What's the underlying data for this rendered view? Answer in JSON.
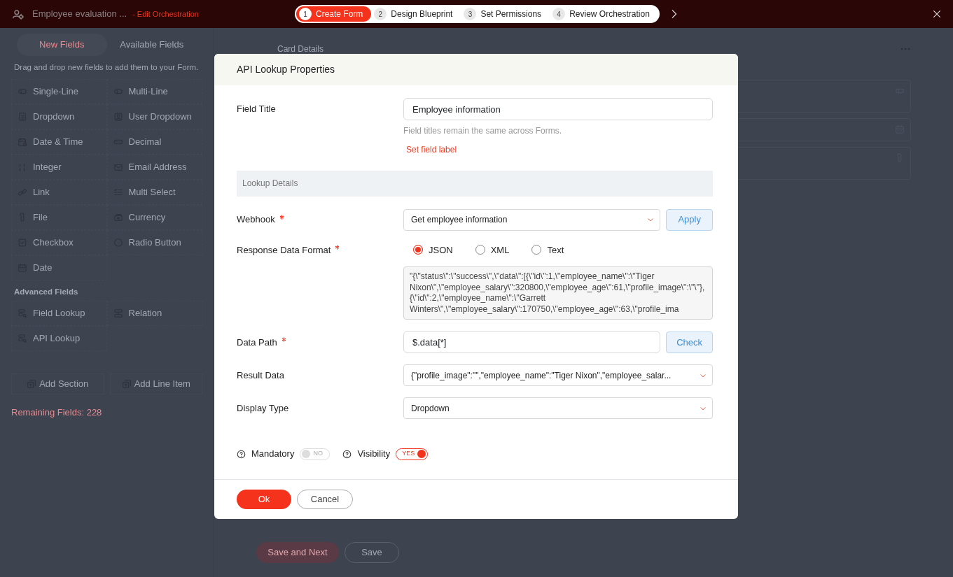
{
  "header": {
    "title": "Employee evaluation ...",
    "subtitle": "- Edit Orchestration",
    "steps": [
      {
        "number": "1",
        "label": "Create Form",
        "selected": true
      },
      {
        "number": "2",
        "label": "Design Blueprint",
        "selected": false
      },
      {
        "number": "3",
        "label": "Set Permissions",
        "selected": false
      },
      {
        "number": "4",
        "label": "Review Orchestration",
        "selected": false
      }
    ]
  },
  "sidebar": {
    "tabs": [
      {
        "label": "New Fields",
        "selected": true
      },
      {
        "label": "Available Fields",
        "selected": false
      }
    ],
    "hint": "Drag and drop new fields to add them to your Form.",
    "fields": [
      "Single-Line",
      "Multi-Line",
      "Dropdown",
      "User Dropdown",
      "Date & Time",
      "Decimal",
      "Integer",
      "Email Address",
      "Link",
      "Multi Select",
      "File",
      "Currency",
      "Checkbox",
      "Radio Button",
      "Date"
    ],
    "advanced_heading": "Advanced Fields",
    "advanced_fields": [
      "Field Lookup",
      "Relation",
      "API Lookup"
    ],
    "actions": [
      "Add Section",
      "Add Line Item"
    ],
    "remaining": "Remaining Fields: 228"
  },
  "canvas": {
    "title": "Card Details",
    "buttons": [
      {
        "label": "Save and Next",
        "kind": "primary"
      },
      {
        "label": "Save",
        "kind": "secondary"
      }
    ]
  },
  "dialog": {
    "title": "API Lookup Properties",
    "field_title": {
      "label": "Field Title",
      "value": "Employee information",
      "help": "Field titles remain the same across Forms.",
      "link": "Set field label"
    },
    "section": "Lookup Details",
    "webhook": {
      "label": "Webhook",
      "required": true,
      "value": "Get employee information",
      "button": "Apply"
    },
    "response_format": {
      "label": "Response Data Format",
      "required": true,
      "options": [
        {
          "label": "JSON",
          "selected": true
        },
        {
          "label": "XML",
          "selected": false
        },
        {
          "label": "Text",
          "selected": false
        }
      ]
    },
    "response_text": "\"{\\\"status\\\":\\\"success\\\",\\\"data\\\":[{\\\"id\\\":1,\\\"employee_name\\\":\\\"Tiger Nixon\\\",\\\"employee_salary\\\":320800,\\\"employee_age\\\":61,\\\"profile_image\\\":\\\"\\\"},{\\\"id\\\":2,\\\"employee_name\\\":\\\"Garrett Winters\\\",\\\"employee_salary\\\":170750,\\\"employee_age\\\":63,\\\"profile_ima",
    "data_path": {
      "label": "Data Path",
      "required": true,
      "value": "$.data[*]",
      "button": "Check"
    },
    "result_data": {
      "label": "Result Data",
      "value": "{\"profile_image\":\"\",\"employee_name\":\"Tiger Nixon\",\"employee_salar..."
    },
    "display_type": {
      "label": "Display Type",
      "value": "Dropdown"
    },
    "toggles": [
      {
        "label": "Mandatory",
        "on": false,
        "text": "NO"
      },
      {
        "label": "Visibility",
        "on": true,
        "text": "YES"
      }
    ],
    "buttons": [
      {
        "label": "Ok",
        "kind": "primary"
      },
      {
        "label": "Cancel",
        "kind": "secondary"
      }
    ]
  }
}
